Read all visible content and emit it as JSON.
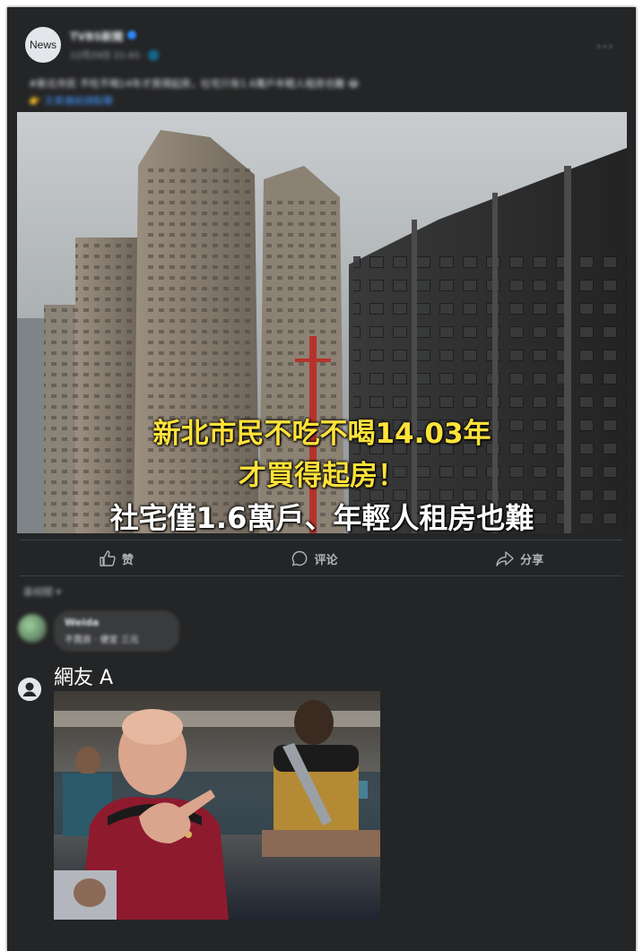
{
  "post": {
    "avatar_label": "News",
    "page_name": "TVBS新聞",
    "timestamp": "12月29日 21:43 · 🌐",
    "caption_line1": "#新北市民 不吃不喝14年才買得起房，社宅只有1.6萬戶年輕人租房也難 😂",
    "caption_line2": "👉 文章連結請點擊",
    "more_label": "···"
  },
  "photo": {
    "headline_line1": "新北市民不吃不喝14.03年",
    "headline_line2": "才買得起房！",
    "headline_line3": "社宅僅1.6萬戶、年輕人租房也難"
  },
  "actions": {
    "like_label": "赞",
    "comment_label": "评论",
    "share_label": "分享"
  },
  "comments": {
    "sort_label": "最相關 ▾",
    "first": {
      "name": "Weida",
      "text": "不買房 · 便宜 三元"
    },
    "second": {
      "name": "網友 A"
    }
  },
  "colors": {
    "card_bg": "#242526",
    "headline_yellow": "#ffe23a",
    "link_blue": "#4599ff"
  }
}
